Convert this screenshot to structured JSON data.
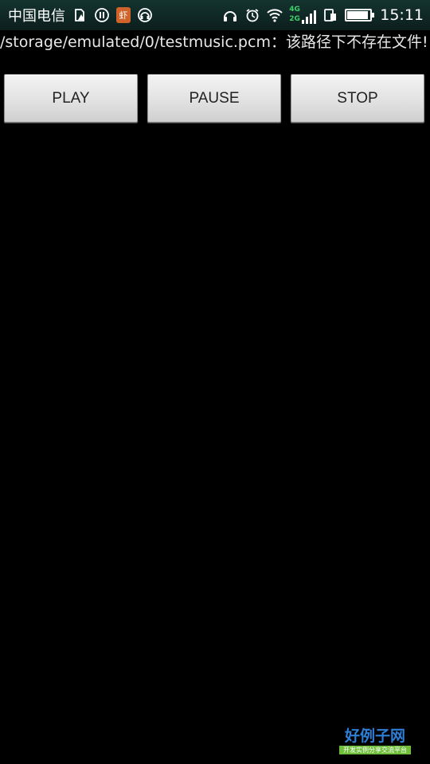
{
  "status_bar": {
    "carrier": "中国电信",
    "time": "15:11",
    "network_top": "4G",
    "network_bottom": "2G",
    "battery_level": 0.85,
    "left_icons": [
      "sim-warning-icon",
      "notification-icon",
      "app-badge-icon",
      "headset-app-icon"
    ],
    "right_icons": [
      "headphones-icon",
      "alarm-icon",
      "wifi-icon",
      "network-signal-icon",
      "data-transfer-icon",
      "battery-icon"
    ],
    "app_badge_glyph": "虾"
  },
  "message": {
    "text": "/storage/emulated/0/testmusic.pcm：该路径下不存在文件!"
  },
  "controls": {
    "play_label": "PLAY",
    "pause_label": "PAUSE",
    "stop_label": "STOP"
  },
  "colors": {
    "background": "#000000",
    "status_bar": "#14332f",
    "button_face": "#e2e2e2",
    "network_label": "#3fd06a",
    "watermark_title": "#2e7ed6",
    "watermark_banner": "#6fbf3a"
  },
  "watermark": {
    "title": "好例子网",
    "subtitle": "开发实例分享交流平台"
  }
}
